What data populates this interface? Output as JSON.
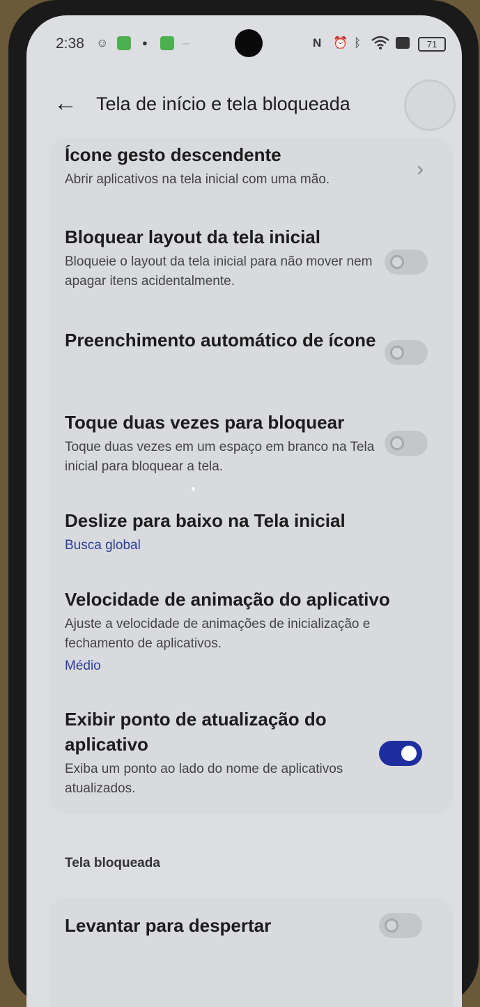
{
  "status_bar": {
    "time": "2:38",
    "battery": "71",
    "icons": [
      "smiley-icon",
      "app-green-icon",
      "mute-icon",
      "app-green-icon",
      "dash-icon",
      "nfc-icon",
      "alarm-icon",
      "bluetooth-icon",
      "wifi-icon",
      "sim-icon",
      "battery-icon"
    ]
  },
  "header": {
    "back_icon": "←",
    "title": "Tela de início e tela bloqueada"
  },
  "settings": [
    {
      "title": "Ícone gesto descendente",
      "description": "Abrir aplicativos na tela inicial com uma mão.",
      "control": "chevron"
    },
    {
      "title": "Bloquear layout da tela inicial",
      "description": "Bloqueie o layout da tela inicial para não mover nem apagar itens acidentalmente.",
      "control": "toggle",
      "on": false
    },
    {
      "title": "Preenchimento automático de ícone",
      "control": "toggle",
      "on": false
    },
    {
      "title": "Toque duas vezes para bloquear",
      "description": "Toque duas vezes em um espaço em branco na Tela inicial para bloquear a tela.",
      "control": "toggle",
      "on": false
    },
    {
      "title": "Deslize para baixo na Tela inicial",
      "value": "Busca global"
    },
    {
      "title": "Velocidade de animação do aplicativo",
      "description": "Ajuste a velocidade de animações de inicialização e fechamento de aplicativos.",
      "value": "Médio"
    },
    {
      "title": "Exibir ponto de atualização do aplicativo",
      "description": "Exiba um ponto ao lado do nome de aplicativos atualizados.",
      "control": "toggle",
      "on": true
    }
  ],
  "lock_section": {
    "header": "Tela bloqueada",
    "items": [
      {
        "title": "Levantar para despertar",
        "control": "toggle",
        "on": false
      }
    ]
  },
  "colors": {
    "accent": "#1e2e9e",
    "link": "#2c3e9e",
    "background": "#dcdee2"
  }
}
